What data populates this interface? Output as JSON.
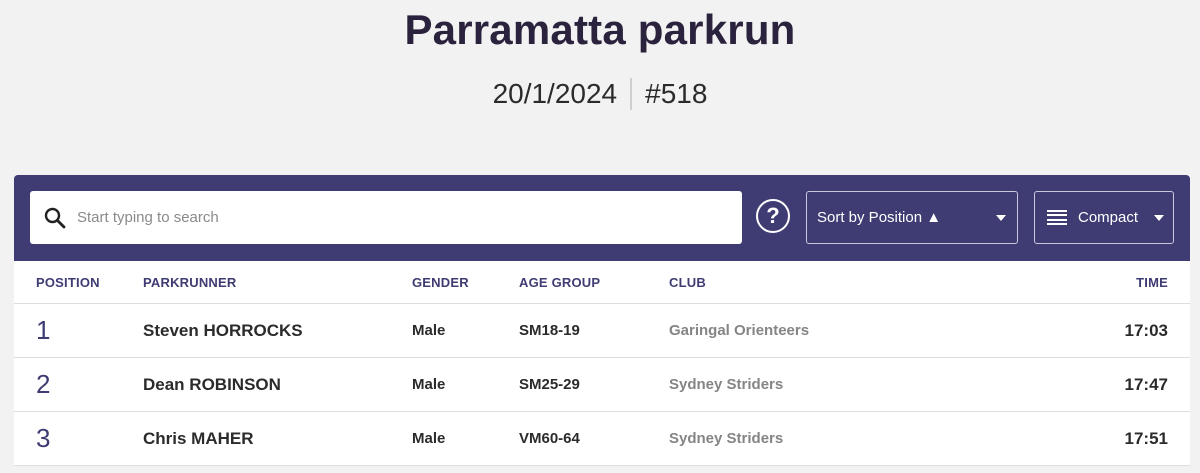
{
  "event": {
    "title": "Parramatta parkrun",
    "date": "20/1/2024",
    "number": "#518"
  },
  "toolbar": {
    "search_placeholder": "Start typing to search",
    "search_value": "",
    "help_label": "?",
    "sort_label": "Sort by Position ▲",
    "view_label": "Compact",
    "background_color": "#3e3c72"
  },
  "table": {
    "columns": {
      "position": "POSITION",
      "parkrunner": "PARKRUNNER",
      "gender": "GENDER",
      "age_group": "AGE GROUP",
      "club": "CLUB",
      "time": "TIME"
    },
    "rows": [
      {
        "position": "1",
        "name": "Steven HORROCKS",
        "gender": "Male",
        "age_group": "SM18-19",
        "club": "Garingal Orienteers",
        "time": "17:03"
      },
      {
        "position": "2",
        "name": "Dean ROBINSON",
        "gender": "Male",
        "age_group": "SM25-29",
        "club": "Sydney Striders",
        "time": "17:47"
      },
      {
        "position": "3",
        "name": "Chris MAHER",
        "gender": "Male",
        "age_group": "VM60-64",
        "club": "Sydney Striders",
        "time": "17:51"
      }
    ]
  }
}
